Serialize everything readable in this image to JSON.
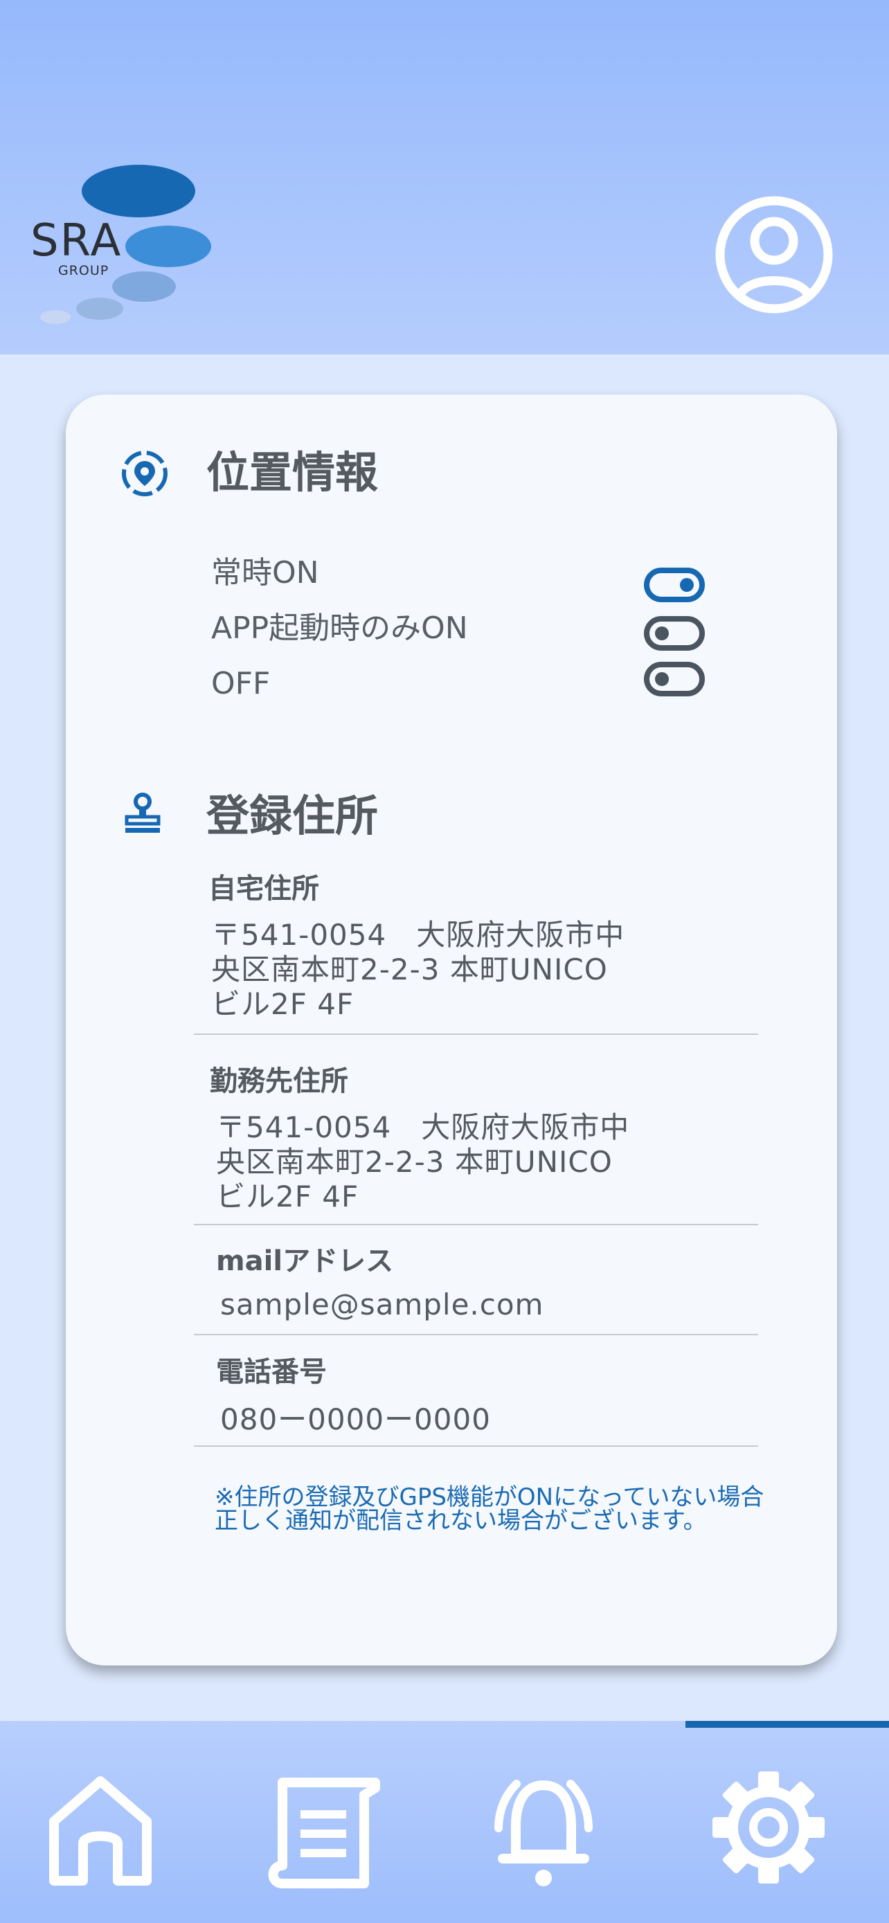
{
  "header": {
    "logo_text": "SRA",
    "logo_sub": "GROUP",
    "profile_icon": "user-circle-icon"
  },
  "location": {
    "title": "位置情報",
    "icon": "location-pin-icon",
    "options": [
      {
        "label": "常時ON",
        "on": true
      },
      {
        "label": "APP起動時のみON",
        "on": false
      },
      {
        "label": "OFF",
        "on": false
      }
    ]
  },
  "address": {
    "title": "登録住所",
    "icon": "stamp-icon",
    "home_label": "自宅住所",
    "home_value": "〒541-0054　大阪府大阪市中\n央区南本町2-2-3 本町UNICO\nビル2F 4F",
    "work_label": "勤務先住所",
    "work_value": "〒541-0054　大阪府大阪市中\n央区南本町2-2-3 本町UNICO\nビル2F 4F",
    "mail_label": "mailアドレス",
    "mail_value": "sample@sample.com",
    "phone_label": "電話番号",
    "phone_value": "080ー0000ー0000"
  },
  "notice": "※住所の登録及びGPS機能がONになっていない場合　正しく通知が配信されない場合がございます。",
  "tabs": [
    {
      "name": "home",
      "icon": "home-icon"
    },
    {
      "name": "document",
      "icon": "document-icon"
    },
    {
      "name": "notification",
      "icon": "bell-icon"
    },
    {
      "name": "settings",
      "icon": "gear-icon",
      "active": true
    }
  ],
  "colors": {
    "accent": "#1866b0",
    "toggle_off": "#4a5560",
    "header_top": "#96b9fc",
    "background": "#dce8fd"
  }
}
